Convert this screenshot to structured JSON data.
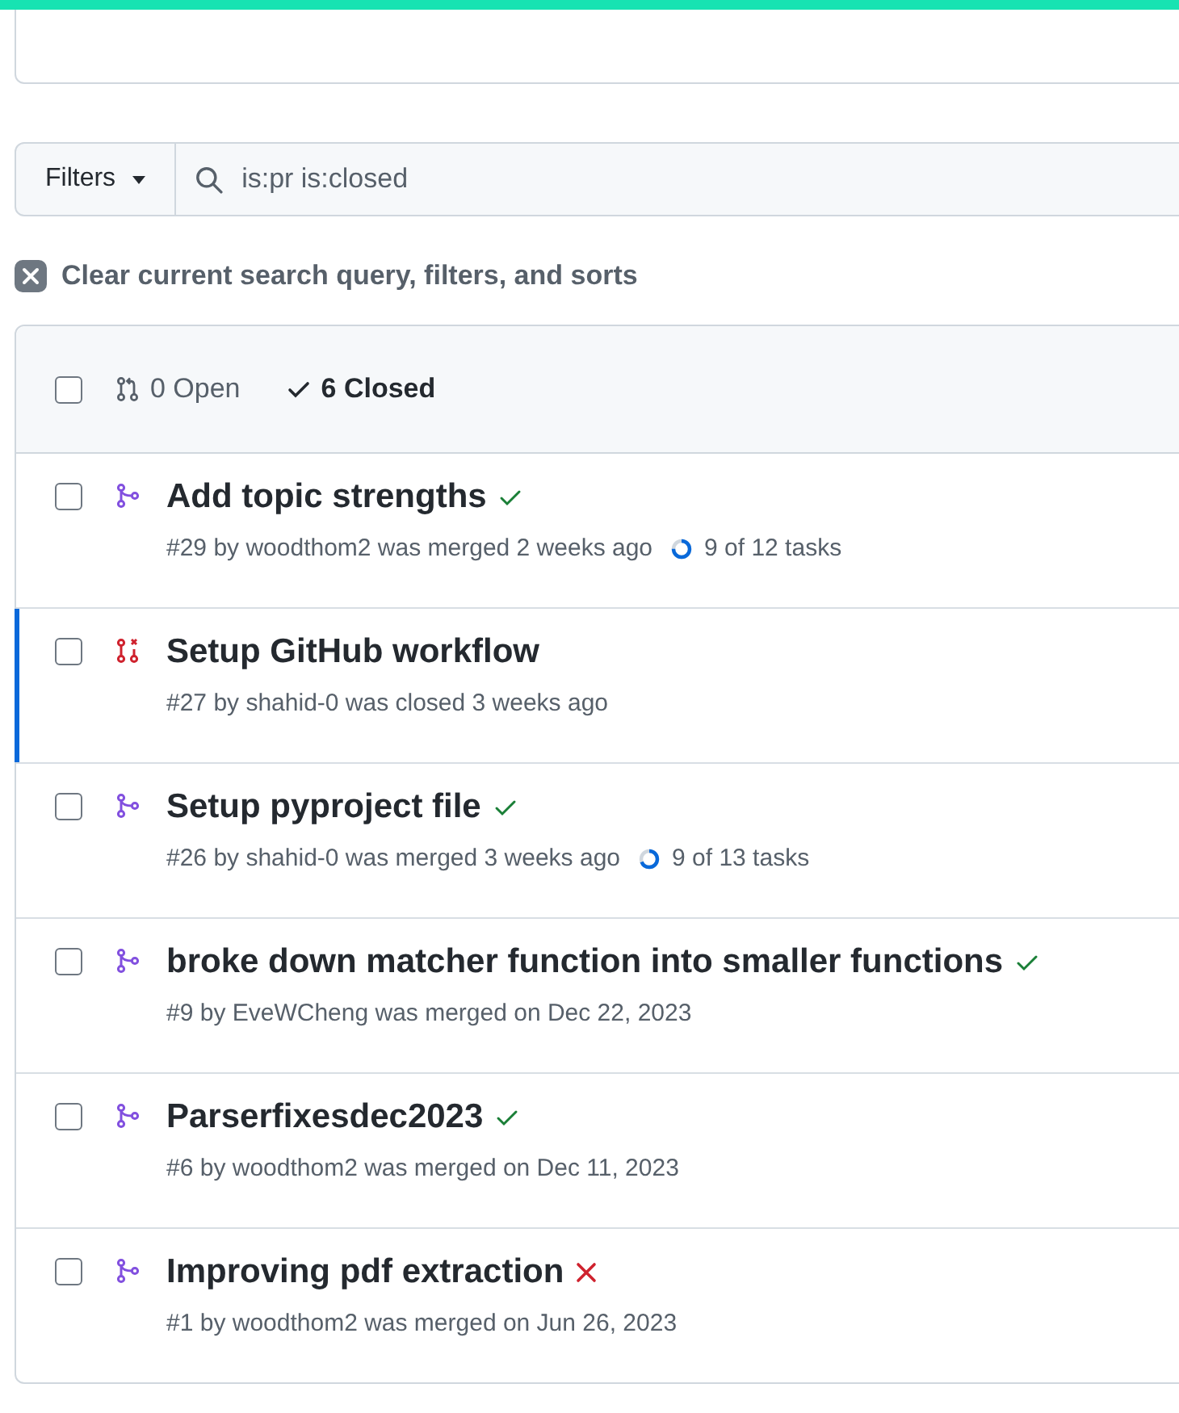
{
  "filters": {
    "label": "Filters",
    "value": "is:pr is:closed"
  },
  "clear": {
    "label": "Clear current search query, filters, and sorts"
  },
  "select_all": {
    "checked": false
  },
  "tabs": [
    {
      "kind": "open",
      "label": "0 Open",
      "selected": false
    },
    {
      "kind": "closed",
      "label": "6 Closed",
      "selected": true
    }
  ],
  "pulls": [
    {
      "title": "Add topic strengths",
      "kind": "merged",
      "checks_passed": true,
      "checked": false,
      "meta": "#29 by woodthom2 was merged 2 weeks ago",
      "tasks": "9 of 12 tasks",
      "level": 0.75,
      "focused": false
    },
    {
      "title": "Setup GitHub workflow",
      "kind": "closed",
      "checked": false,
      "meta": "#27 by shahid-0 was closed 3 weeks ago",
      "focused": true
    },
    {
      "title": "Setup pyproject file",
      "kind": "merged",
      "checks_passed": true,
      "checked": false,
      "meta": "#26 by shahid-0 was merged 3 weeks ago",
      "tasks": "9 of 13 tasks",
      "level": 0.69,
      "focused": false
    },
    {
      "title": "broke down matcher function into smaller functions",
      "kind": "merged",
      "checks_passed": true,
      "checked": false,
      "meta": "#9 by EveWCheng was merged on Dec 22, 2023",
      "focused": false
    },
    {
      "title": "Parserfixesdec2023",
      "kind": "merged",
      "checks_passed": true,
      "checked": false,
      "meta": "#6 by woodthom2 was merged on Dec 11, 2023",
      "focused": false
    },
    {
      "title": "Improving pdf extraction",
      "kind": "merged",
      "checks_passed": false,
      "checked": false,
      "meta": "#1 by woodthom2 was merged on Jun 26, 2023",
      "focused": false
    }
  ]
}
